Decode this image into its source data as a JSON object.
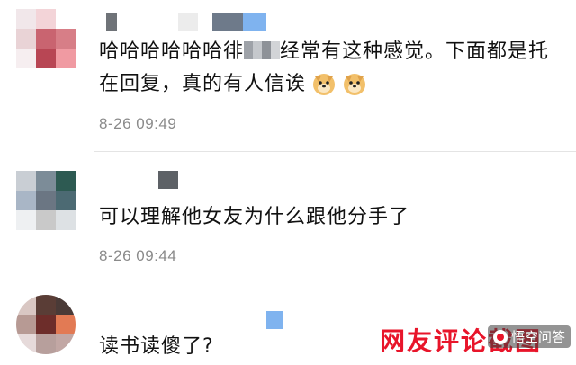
{
  "comments": [
    {
      "text_before": "哈哈哈哈哈哈徘",
      "text_after": "经常有这种感觉。下面都是托在回复，真的有人信诶",
      "emoji": [
        "doge-emoji",
        "doge-emoji"
      ],
      "time": "8-26 09:49"
    },
    {
      "text": "可以理解他女友为什么跟他分手了",
      "time": "8-26 09:44"
    },
    {
      "text": "读书读傻了?"
    }
  ],
  "watermark": {
    "main": "网友评论截图",
    "badge": "悟空问答"
  },
  "colors": {
    "time_gray": "#8a8a8a",
    "watermark_red": "#e8152a",
    "name_blue": "#7fb3ef"
  }
}
